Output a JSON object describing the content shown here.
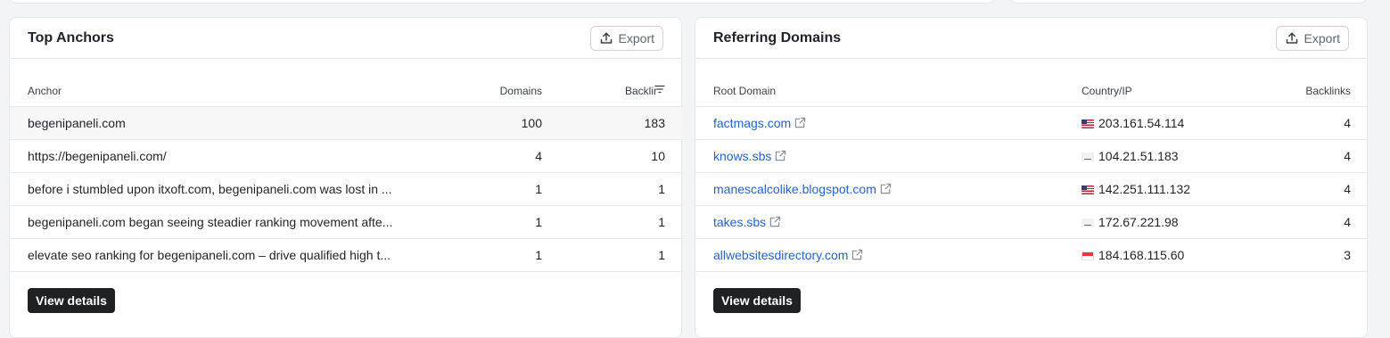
{
  "anchors": {
    "title": "Top Anchors",
    "export_label": "Export",
    "columns": {
      "anchor": "Anchor",
      "domains": "Domains",
      "backlinks": "Backlir"
    },
    "rows": [
      {
        "anchor": "begenipaneli.com",
        "domains": "100",
        "backlinks": "183"
      },
      {
        "anchor": "https://begenipaneli.com/",
        "domains": "4",
        "backlinks": "10"
      },
      {
        "anchor": "before i stumbled upon itxoft.com, begenipaneli.com was lost in ...",
        "domains": "1",
        "backlinks": "1"
      },
      {
        "anchor": "begenipaneli.com began seeing steadier ranking movement afte...",
        "domains": "1",
        "backlinks": "1"
      },
      {
        "anchor": "elevate seo ranking for begenipaneli.com – drive qualified high t...",
        "domains": "1",
        "backlinks": "1"
      }
    ],
    "view_details_label": "View details"
  },
  "referring": {
    "title": "Referring Domains",
    "export_label": "Export",
    "columns": {
      "root_domain": "Root Domain",
      "country_ip": "Country/IP",
      "backlinks": "Backlinks"
    },
    "rows": [
      {
        "domain": "factmags.com",
        "flag": "us",
        "ip": "203.161.54.114",
        "backlinks": "4"
      },
      {
        "domain": "knows.sbs",
        "flag": "none",
        "ip": "104.21.51.183",
        "backlinks": "4"
      },
      {
        "domain": "manescalcolike.blogspot.com",
        "flag": "us",
        "ip": "142.251.111.132",
        "backlinks": "4"
      },
      {
        "domain": "takes.sbs",
        "flag": "none",
        "ip": "172.67.221.98",
        "backlinks": "4"
      },
      {
        "domain": "allwebsitesdirectory.com",
        "flag": "sg",
        "ip": "184.168.115.60",
        "backlinks": "3"
      }
    ],
    "view_details_label": "View details"
  },
  "icons": {
    "export": "upload-icon",
    "external": "external-link-icon",
    "sort": "sort-icon"
  },
  "colors": {
    "link": "#2563c8",
    "button_dark": "#1f2123"
  }
}
